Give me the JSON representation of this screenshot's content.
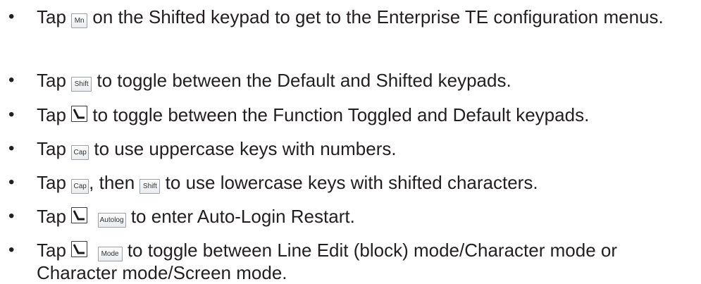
{
  "bullet_glyph": "•",
  "items": [
    {
      "before": "Tap ",
      "key1": "Mn",
      "after": " on the Shifted keypad to get to the Enterprise TE configuration menus."
    },
    {
      "before": "Tap ",
      "key1": "Shift",
      "after": " to toggle between the Default and Shifted keypads."
    },
    {
      "before": "Tap ",
      "key1_icon": "function-toggle-icon",
      "after": " to toggle between the Function Toggled and Default keypads."
    },
    {
      "before": "Tap ",
      "key1": "Cap",
      "after": " to use uppercase keys with numbers."
    },
    {
      "before": "Tap ",
      "key1": "Cap",
      "middle": ", then ",
      "key2": "Shift",
      "after": " to use lowercase keys with shifted characters."
    },
    {
      "before": "Tap ",
      "key1_icon": "function-toggle-icon",
      "key2": "Autolog",
      "after": " to enter Auto-Login Restart."
    },
    {
      "before": "Tap ",
      "key1_icon": "function-toggle-icon",
      "key2": "Mode",
      "after": " to toggle between Line Edit (block) mode/Character mode or Character mode/Screen mode."
    }
  ]
}
